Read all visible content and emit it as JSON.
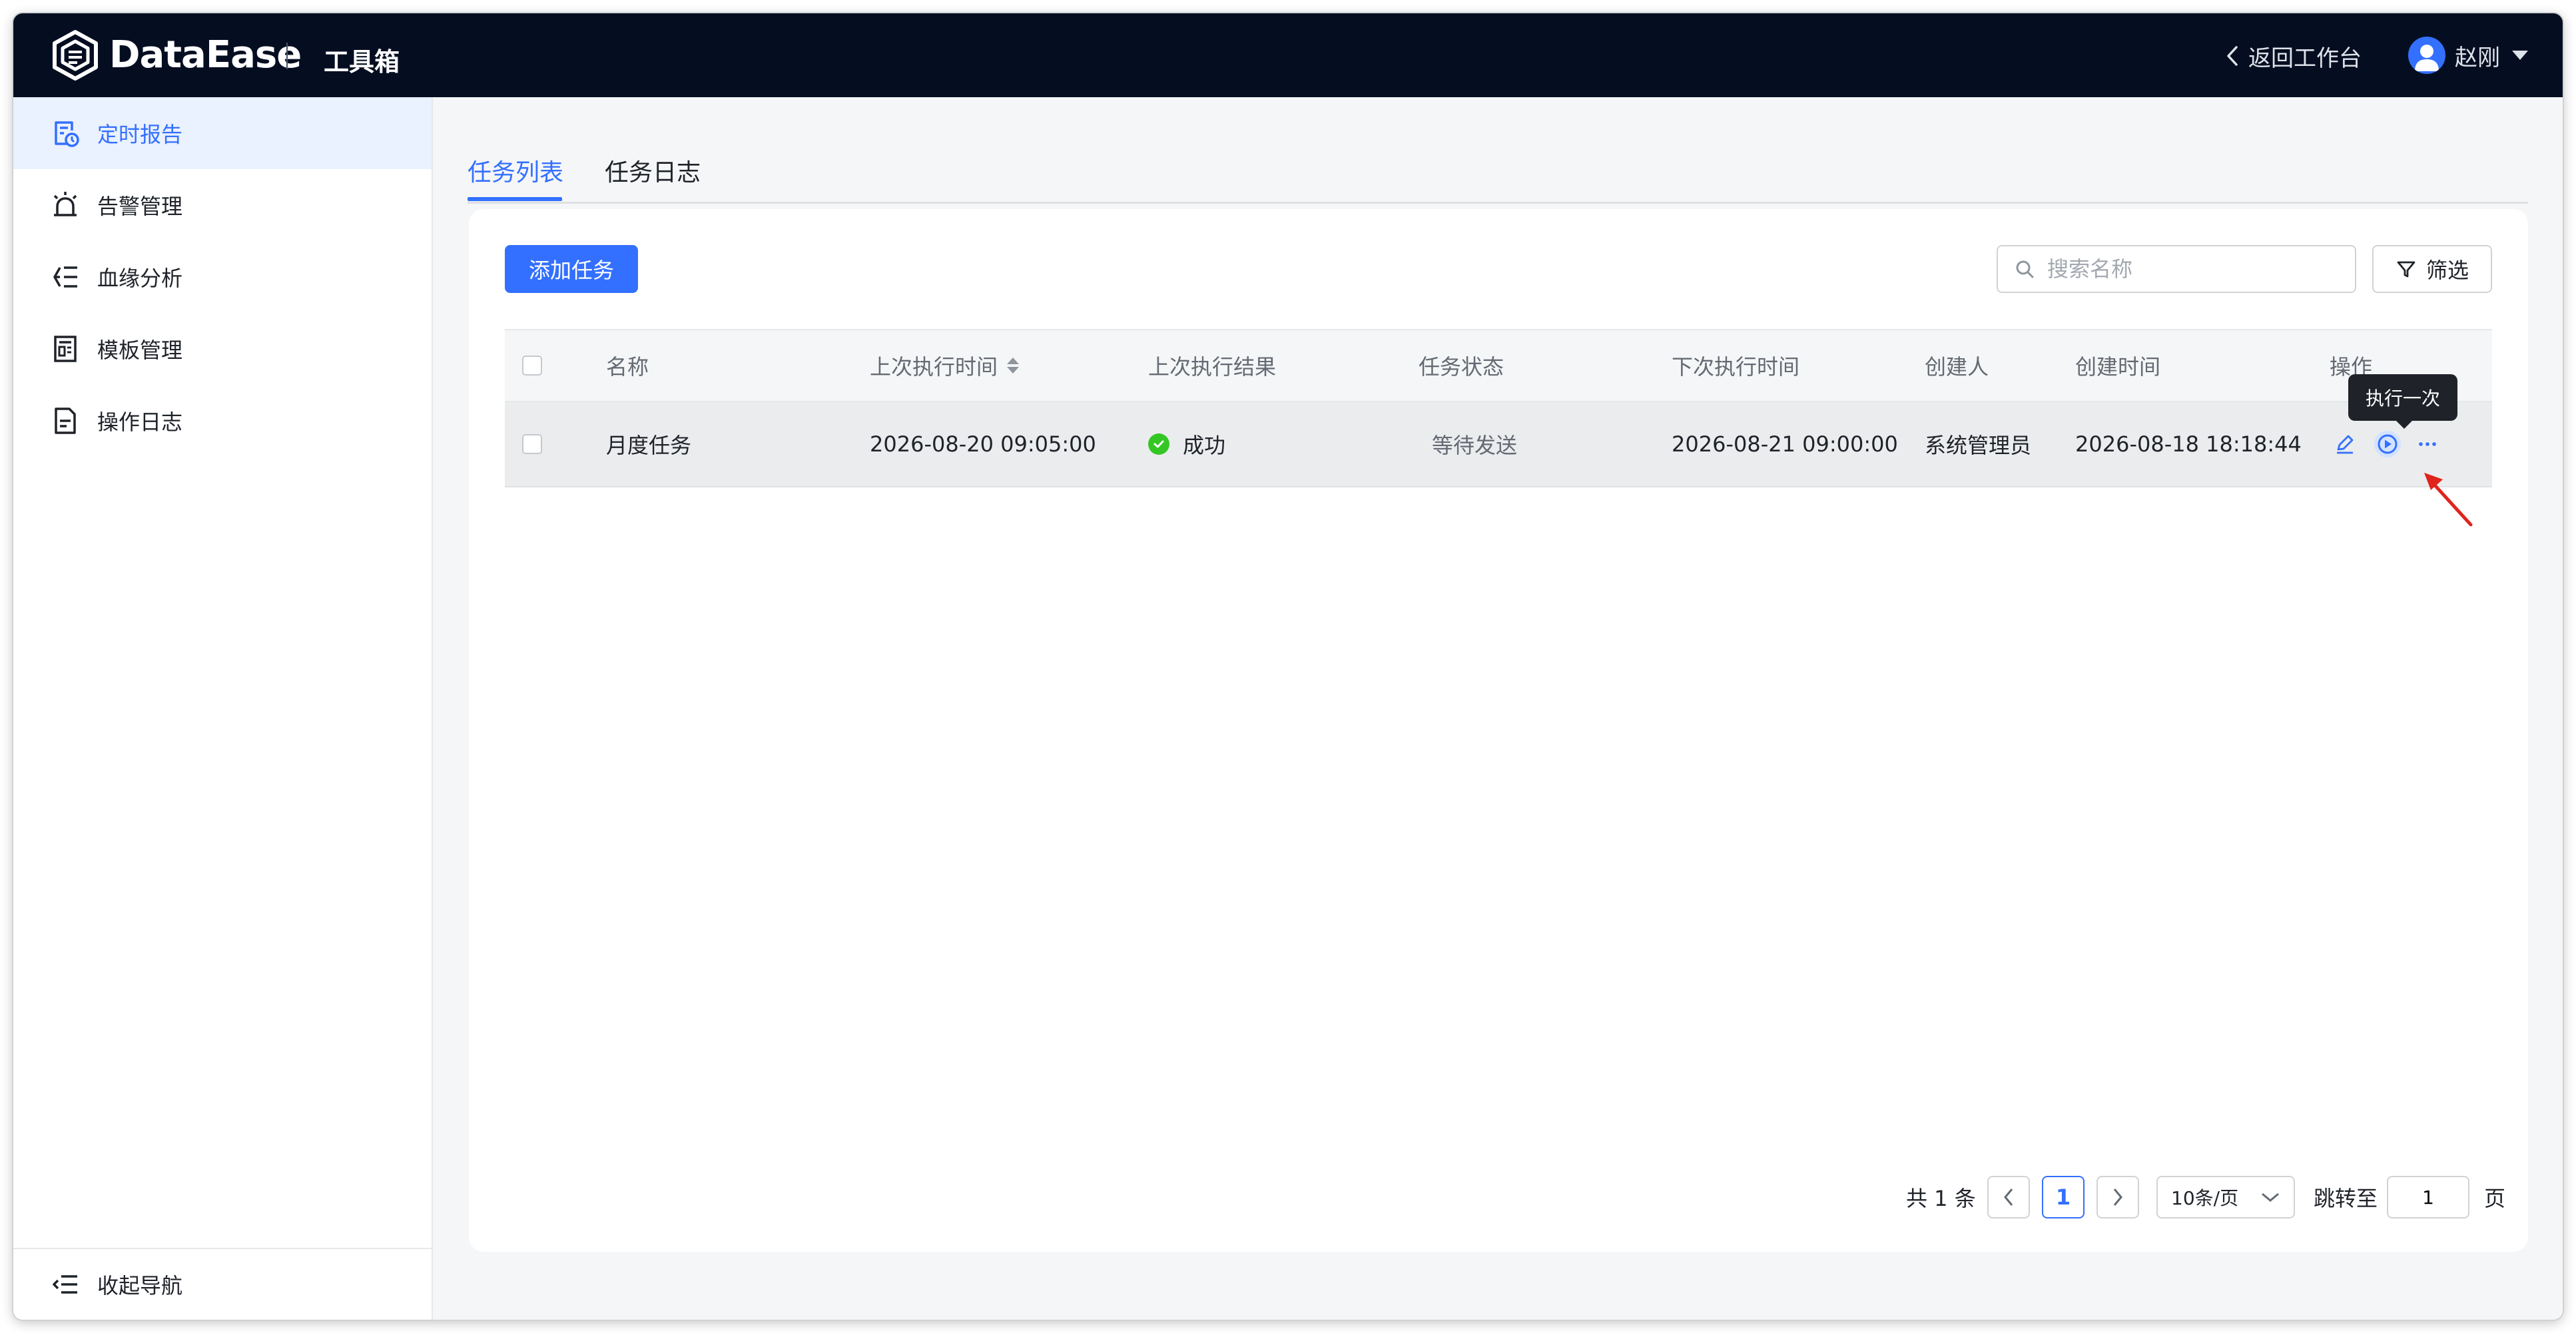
{
  "header": {
    "brand": "DataEase",
    "app_name": "工具箱",
    "back_label": "返回工作台",
    "user_name": "赵刚"
  },
  "sidebar": {
    "items": [
      {
        "label": "定时报告",
        "icon": "scheduled-report-icon",
        "active": true
      },
      {
        "label": "告警管理",
        "icon": "alarm-icon",
        "active": false
      },
      {
        "label": "血缘分析",
        "icon": "lineage-icon",
        "active": false
      },
      {
        "label": "模板管理",
        "icon": "template-icon",
        "active": false
      },
      {
        "label": "操作日志",
        "icon": "log-icon",
        "active": false
      }
    ],
    "collapse_label": "收起导航"
  },
  "tabs": [
    {
      "label": "任务列表",
      "active": true
    },
    {
      "label": "任务日志",
      "active": false
    }
  ],
  "toolbar": {
    "add_label": "添加任务",
    "search_placeholder": "搜索名称",
    "filter_label": "筛选"
  },
  "table": {
    "columns": [
      "名称",
      "上次执行时间",
      "上次执行结果",
      "任务状态",
      "下次执行时间",
      "创建人",
      "创建时间",
      "操作"
    ],
    "rows": [
      {
        "name": "月度任务",
        "last_run": "2026-08-20 09:05:00",
        "last_result": "成功",
        "status": "等待发送",
        "next_run": "2026-08-21 09:00:00",
        "creator": "系统管理员",
        "created_at": "2026-08-18 18:18:44"
      }
    ]
  },
  "tooltip": "执行一次",
  "pagination": {
    "total": "共 1 条",
    "current_page": "1",
    "page_size": "10条/页",
    "jump_label": "跳转至",
    "jump_value": "1",
    "page_suffix": "页"
  },
  "colors": {
    "accent": "#3370ff",
    "topbar": "#050e21",
    "success": "#34c724"
  }
}
